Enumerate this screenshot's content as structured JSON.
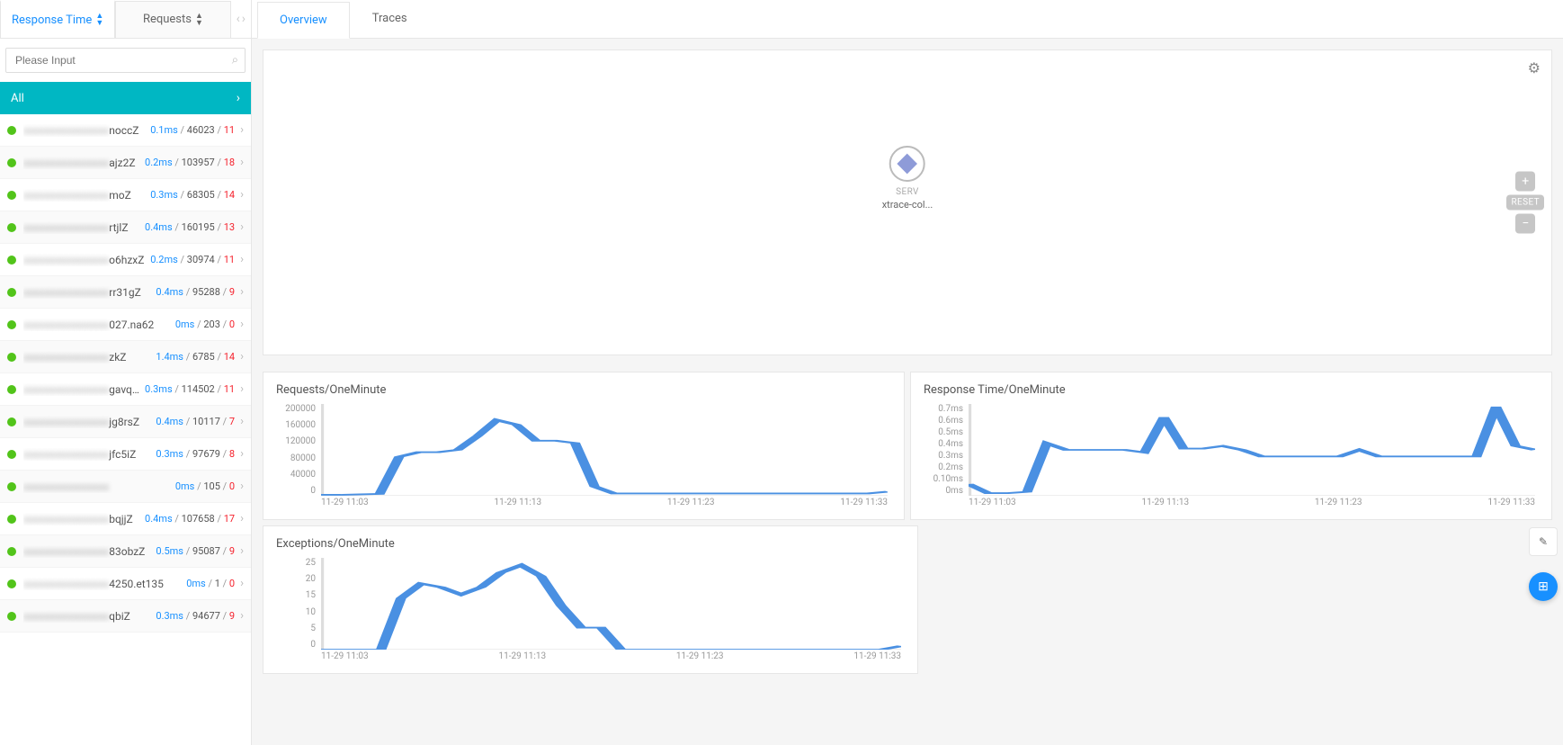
{
  "sidebar": {
    "tabs": [
      {
        "label": "Response Time",
        "active": true
      },
      {
        "label": "Requests",
        "active": false
      }
    ],
    "search_placeholder": "Please Input",
    "all_label": "All",
    "items": [
      {
        "suffix": "noccZ",
        "rt": "0.1ms",
        "req": "46023",
        "err": "11"
      },
      {
        "suffix": "ajz2Z",
        "rt": "0.2ms",
        "req": "103957",
        "err": "18"
      },
      {
        "suffix": "moZ",
        "rt": "0.3ms",
        "req": "68305",
        "err": "14"
      },
      {
        "suffix": "rtjlZ",
        "rt": "0.4ms",
        "req": "160195",
        "err": "13"
      },
      {
        "suffix": "o6hzxZ",
        "rt": "0.2ms",
        "req": "30974",
        "err": "11"
      },
      {
        "suffix": "rr31gZ",
        "rt": "0.4ms",
        "req": "95288",
        "err": "9"
      },
      {
        "suffix": "027.na62",
        "rt": "0ms",
        "req": "203",
        "err": "0"
      },
      {
        "suffix": "zkZ",
        "rt": "1.4ms",
        "req": "6785",
        "err": "14"
      },
      {
        "suffix": "gavqsZ",
        "rt": "0.3ms",
        "req": "114502",
        "err": "11"
      },
      {
        "suffix": "jg8rsZ",
        "rt": "0.4ms",
        "req": "10117",
        "err": "7"
      },
      {
        "suffix": "jfc5iZ",
        "rt": "0.3ms",
        "req": "97679",
        "err": "8"
      },
      {
        "suffix": "",
        "rt": "0ms",
        "req": "105",
        "err": "0"
      },
      {
        "suffix": "bqjjZ",
        "rt": "0.4ms",
        "req": "107658",
        "err": "17"
      },
      {
        "suffix": "83obzZ",
        "rt": "0.5ms",
        "req": "95087",
        "err": "9"
      },
      {
        "suffix": "4250.et135",
        "rt": "0ms",
        "req": "1",
        "err": "0"
      },
      {
        "suffix": "qbiZ",
        "rt": "0.3ms",
        "req": "94677",
        "err": "9"
      }
    ]
  },
  "main": {
    "tabs": [
      {
        "label": "Overview",
        "active": true
      },
      {
        "label": "Traces",
        "active": false
      }
    ],
    "node": {
      "type": "SERV",
      "label": "xtrace-col..."
    },
    "reset_label": "RESET"
  },
  "chart_data": [
    {
      "type": "line",
      "title": "Requests/OneMinute",
      "x": [
        "11-29 11:03",
        "11-29 11:13",
        "11-29 11:23",
        "11-29 11:33"
      ],
      "y_ticks": [
        "200000",
        "160000",
        "120000",
        "80000",
        "40000",
        "0"
      ],
      "ylim": [
        0,
        200000
      ],
      "series": [
        {
          "name": "requests",
          "values": [
            2000,
            2000,
            3000,
            4000,
            85000,
            95000,
            95000,
            100000,
            130000,
            165000,
            155000,
            120000,
            120000,
            115000,
            20000,
            5000,
            5000,
            5000,
            5000,
            5000,
            5000,
            5000,
            5000,
            5000,
            5000,
            5000,
            5000,
            5000,
            5000,
            9000
          ]
        }
      ]
    },
    {
      "type": "line",
      "title": "Response Time/OneMinute",
      "x": [
        "11-29 11:03",
        "11-29 11:13",
        "11-29 11:23",
        "11-29 11:33"
      ],
      "y_ticks": [
        "0.7ms",
        "0.6ms",
        "0.5ms",
        "0.4ms",
        "0.3ms",
        "0.2ms",
        "0.10ms",
        "0ms"
      ],
      "ylim": [
        0,
        0.7
      ],
      "series": [
        {
          "name": "rt",
          "values": [
            0.09,
            0.02,
            0.02,
            0.03,
            0.4,
            0.35,
            0.35,
            0.35,
            0.35,
            0.33,
            0.6,
            0.36,
            0.36,
            0.38,
            0.35,
            0.3,
            0.3,
            0.3,
            0.3,
            0.3,
            0.35,
            0.3,
            0.3,
            0.3,
            0.3,
            0.3,
            0.3,
            0.68,
            0.38,
            0.35
          ]
        }
      ]
    },
    {
      "type": "line",
      "title": "Exceptions/OneMinute",
      "x": [
        "11-29 11:03",
        "11-29 11:13",
        "11-29 11:23",
        "11-29 11:33"
      ],
      "y_ticks": [
        "25",
        "20",
        "15",
        "10",
        "5",
        "0"
      ],
      "ylim": [
        0,
        25
      ],
      "series": [
        {
          "name": "exceptions",
          "values": [
            0,
            0,
            0,
            0,
            14,
            18,
            17,
            15,
            17,
            21,
            23,
            20,
            12,
            6,
            6,
            0,
            0,
            0,
            0,
            0,
            0,
            0,
            0,
            0,
            0,
            0,
            0,
            0,
            0,
            1
          ]
        }
      ]
    }
  ]
}
